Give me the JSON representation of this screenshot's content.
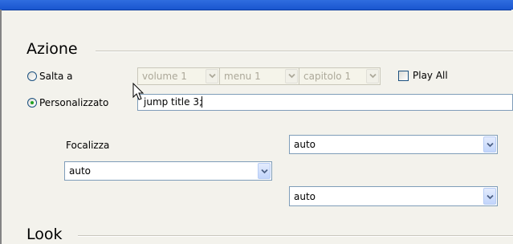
{
  "window": {
    "title": ""
  },
  "sections": {
    "action": {
      "title": "Azione"
    },
    "look": {
      "title": "Look"
    }
  },
  "action": {
    "radio_goto": {
      "label": "Salta a",
      "selected": false
    },
    "radio_custom": {
      "label": "Personalizzato",
      "selected": true
    },
    "volume_select": {
      "value": "volume 1",
      "enabled": false
    },
    "menu_select": {
      "value": "menu 1",
      "enabled": false
    },
    "chapter_select": {
      "value": "capitolo 1",
      "enabled": false
    },
    "play_all": {
      "label": "Play All",
      "checked": false
    },
    "custom_command": {
      "value": "jump title 3;"
    }
  },
  "focus": {
    "label": "Focalizza",
    "up_select": {
      "value": "auto"
    },
    "left_select": {
      "value": "auto"
    },
    "down_select": {
      "value": "auto"
    }
  },
  "colors": {
    "titlebar": "#1a56cf",
    "background": "#f3f2ec",
    "radio_dot": "#21a121",
    "field_border": "#7f9db9"
  },
  "icons": {
    "cursor": "mouse-pointer-icon",
    "dropdown": "chevron-down-icon"
  }
}
